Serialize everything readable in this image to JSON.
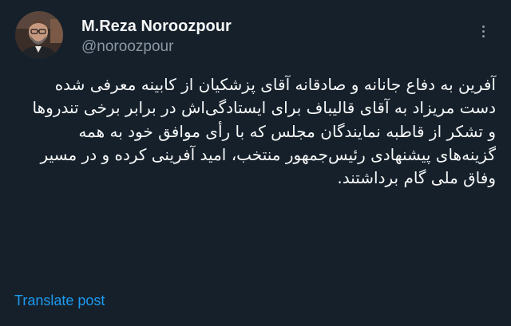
{
  "author": {
    "display_name": "M.Reza Noroozpour",
    "handle": "@noroozpour",
    "avatar_icon": "profile-photo"
  },
  "menu": {
    "icon": "more-options-icon"
  },
  "tweet": {
    "lines": [
      "آفرین به دفاع جانانه و صادقانه آقای پزشکیان از کابینه معرفی شده",
      "دست مریزاد به آقای قالیباف برای ایستادگی‌اش در برابر برخی تندروها",
      "و تشکر از قاطبه نمایندگان مجلس که با رأی موافق خود به همه گزینه‌های پیشنهادی رئیس‌جمهور منتخب، امید آفرینی کرده و در مسیر وفاق ملی گام برداشتند."
    ]
  },
  "actions": {
    "translate_label": "Translate post"
  },
  "colors": {
    "background": "#15202b",
    "text": "#f7f9f9",
    "secondary": "#8b98a5",
    "link": "#1d9bf0"
  }
}
